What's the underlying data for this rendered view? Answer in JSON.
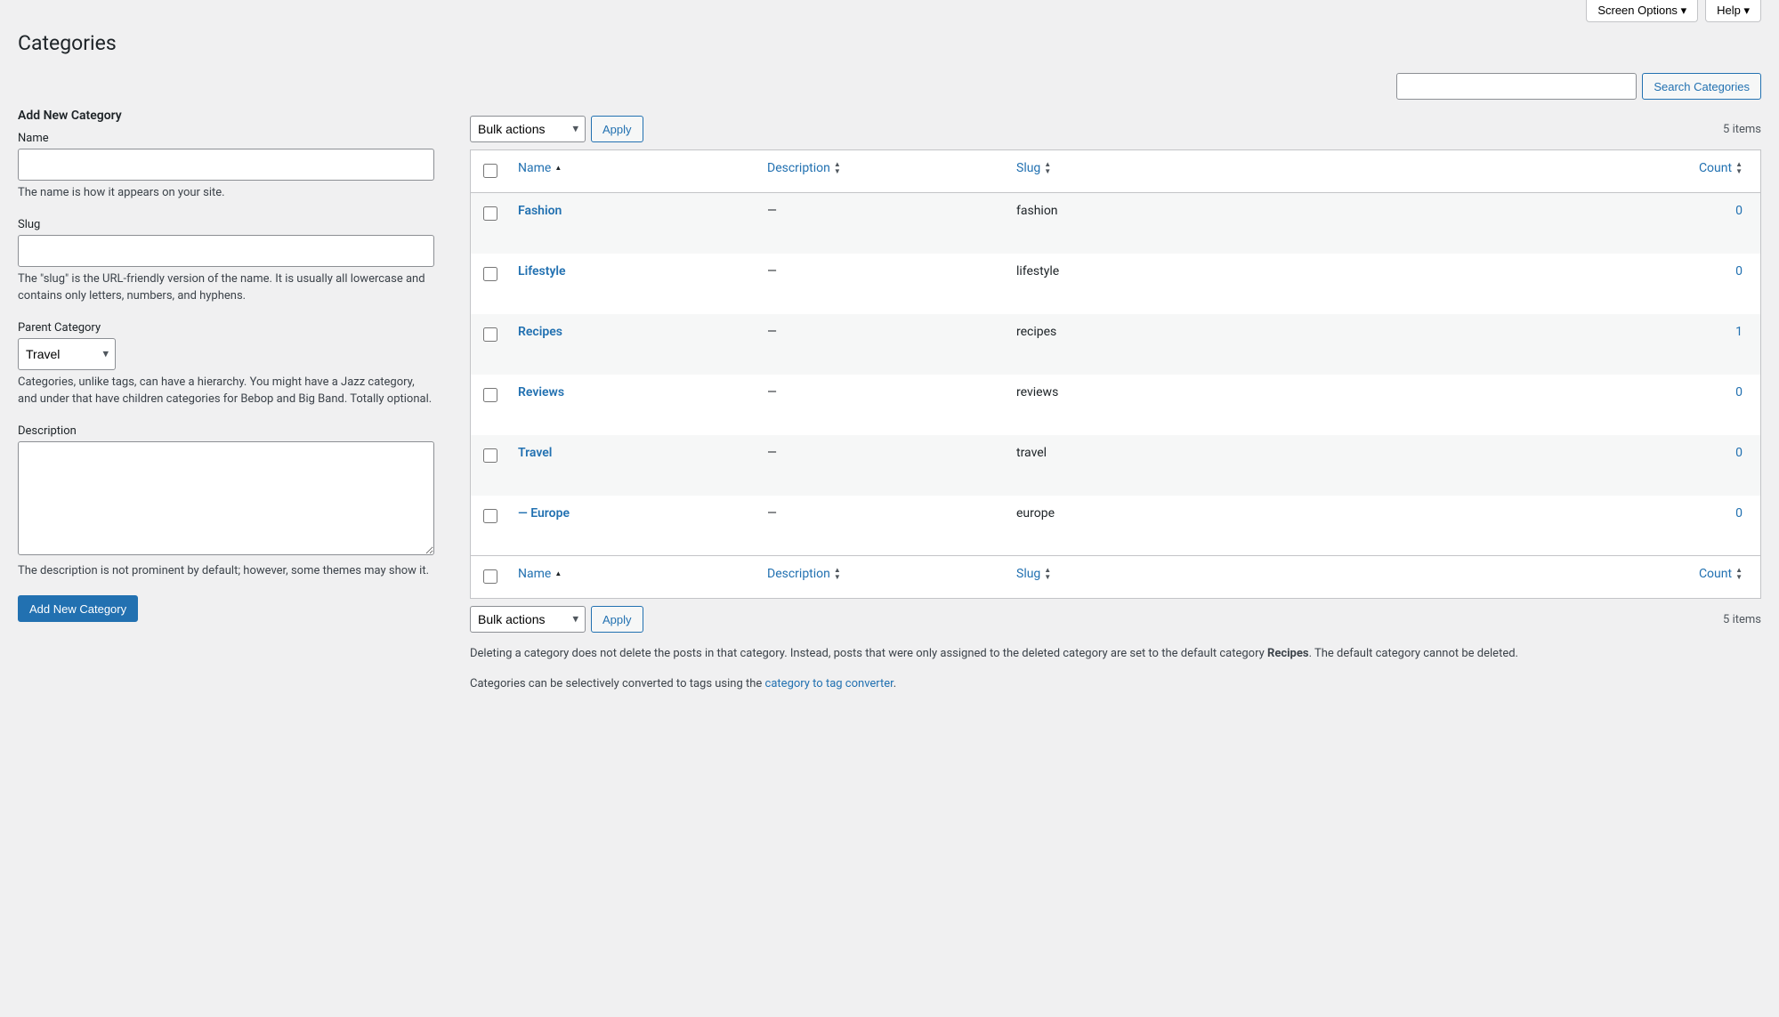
{
  "header": {
    "screen_options": "Screen Options",
    "help": "Help",
    "page_title": "Categories"
  },
  "search": {
    "input_value": "",
    "button": "Search Categories"
  },
  "form": {
    "heading": "Add New Category",
    "name_label": "Name",
    "name_help": "The name is how it appears on your site.",
    "slug_label": "Slug",
    "slug_help": "The \"slug\" is the URL-friendly version of the name. It is usually all lowercase and contains only letters, numbers, and hyphens.",
    "parent_label": "Parent Category",
    "parent_selected": "Travel",
    "parent_help": "Categories, unlike tags, can have a hierarchy. You might have a Jazz category, and under that have children categories for Bebop and Big Band. Totally optional.",
    "desc_label": "Description",
    "desc_help": "The description is not prominent by default; however, some themes may show it.",
    "submit": "Add New Category"
  },
  "bulk": {
    "select_label": "Bulk actions",
    "apply": "Apply"
  },
  "table": {
    "items_count": "5 items",
    "cols": {
      "name": "Name",
      "desc": "Description",
      "slug": "Slug",
      "count": "Count"
    },
    "rows": [
      {
        "name": "Fashion",
        "desc": "—",
        "slug": "fashion",
        "count": "0",
        "indent": false
      },
      {
        "name": "Lifestyle",
        "desc": "—",
        "slug": "lifestyle",
        "count": "0",
        "indent": false
      },
      {
        "name": "Recipes",
        "desc": "—",
        "slug": "recipes",
        "count": "1",
        "indent": false
      },
      {
        "name": "Reviews",
        "desc": "—",
        "slug": "reviews",
        "count": "0",
        "indent": false
      },
      {
        "name": "Travel",
        "desc": "—",
        "slug": "travel",
        "count": "0",
        "indent": false
      },
      {
        "name": "— Europe",
        "desc": "—",
        "slug": "europe",
        "count": "0",
        "indent": false
      }
    ]
  },
  "footer": {
    "note1_a": "Deleting a category does not delete the posts in that category. Instead, posts that were only assigned to the deleted category are set to the default category ",
    "note1_b": "Recipes",
    "note1_c": ". The default category cannot be deleted.",
    "note2_a": "Categories can be selectively converted to tags using the ",
    "note2_link": "category to tag converter",
    "note2_b": "."
  }
}
